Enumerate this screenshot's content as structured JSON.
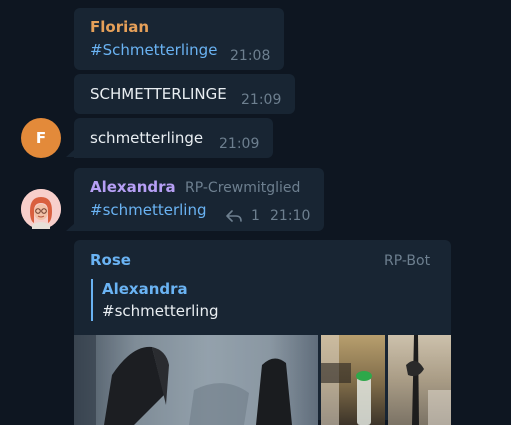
{
  "messages": [
    {
      "sender": "Florian",
      "text": "#Schmetterlinge",
      "time": "21:08"
    },
    {
      "text": "SCHMETTERLINGE",
      "time": "21:09"
    },
    {
      "text": "schmetterlinge",
      "time": "21:09",
      "avatar_letter": "F"
    },
    {
      "sender": "Alexandra",
      "role": "RP-Crewmitglied",
      "text": "#schmetterling",
      "replies": "1",
      "time": "21:10"
    },
    {
      "sender": "Rose",
      "role": "RP-Bot",
      "quote_sender": "Alexandra",
      "quote_text": "#schmetterling"
    }
  ],
  "colors": {
    "background": "#0e1621",
    "bubble": "#182533",
    "florian_name": "#e6a059",
    "alexandra_name": "#b69ff5",
    "rose_name": "#6ab3f3",
    "hashtag": "#6ab3f3",
    "avatar_f": "#e38a3a"
  },
  "icons": {
    "reply": "reply-arrow-icon"
  }
}
